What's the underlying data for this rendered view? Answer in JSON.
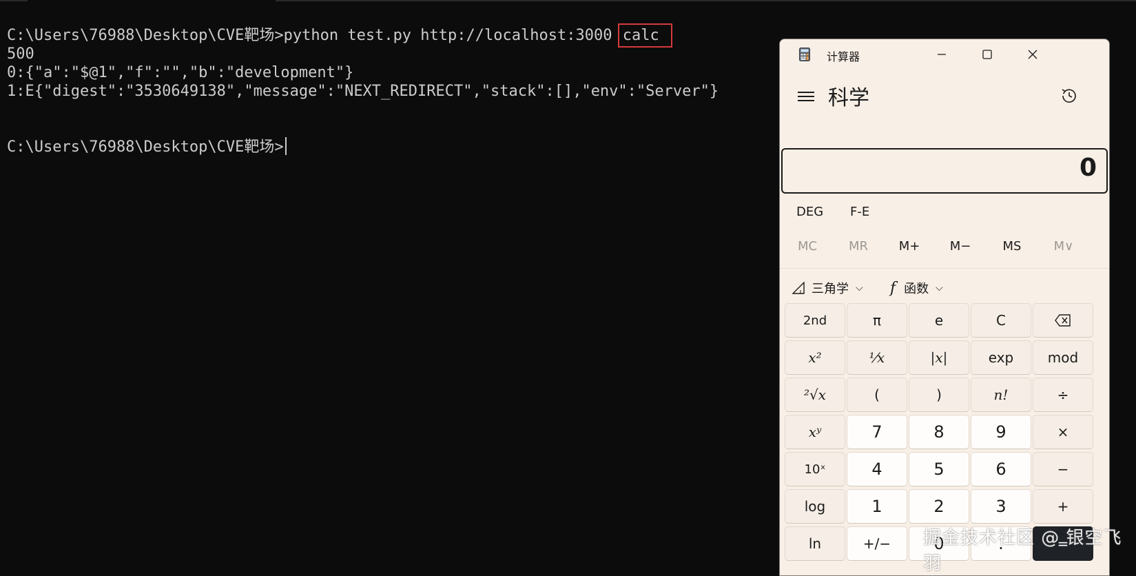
{
  "terminal": {
    "line1_prompt": "C:\\Users\\76988\\Desktop\\CVE靶场>",
    "line1_command": "python test.py http://localhost:3000 ",
    "line1_arg": "calc",
    "line2": "500",
    "line3": "0:{\"a\":\"$@1\",\"f\":\"\",\"b\":\"development\"}",
    "line4": "1:E{\"digest\":\"3530649138\",\"message\":\"NEXT_REDIRECT\",\"stack\":[],\"env\":\"Server\"}",
    "line5_prompt": "C:\\Users\\76988\\Desktop\\CVE靶场>",
    "highlight_color": "#d63a3a"
  },
  "calculator": {
    "window_title": "计算器",
    "mode_title": "科学",
    "display_value": "0",
    "angle_mode": "DEG",
    "notation_mode": "F-E",
    "memory": [
      "MC",
      "MR",
      "M+",
      "M−",
      "MS",
      "M∨"
    ],
    "dropdowns": {
      "trig": "三角学",
      "func": "函数"
    },
    "keys": {
      "r1": [
        "2nd",
        "π",
        "e",
        "C",
        "⌫"
      ],
      "r2": [
        "x²",
        "¹⁄x",
        "|x|",
        "exp",
        "mod"
      ],
      "r3": [
        "²√x",
        "(",
        ")",
        "n!",
        "÷"
      ],
      "r4": [
        "xʸ",
        "7",
        "8",
        "9",
        "×"
      ],
      "r5": [
        "10ˣ",
        "4",
        "5",
        "6",
        "−"
      ],
      "r6": [
        "log",
        "1",
        "2",
        "3",
        "+"
      ],
      "r7": [
        "ln",
        "+/−",
        "0",
        ".",
        "="
      ]
    },
    "icons": [
      "calculator-app-icon",
      "minimize-icon",
      "maximize-icon",
      "close-icon",
      "hamburger-menu-icon",
      "history-icon",
      "triangle-icon",
      "function-icon",
      "chevron-down-icon",
      "backspace-icon"
    ]
  },
  "watermark": "掘金技术社区 @ 银空飞羽"
}
